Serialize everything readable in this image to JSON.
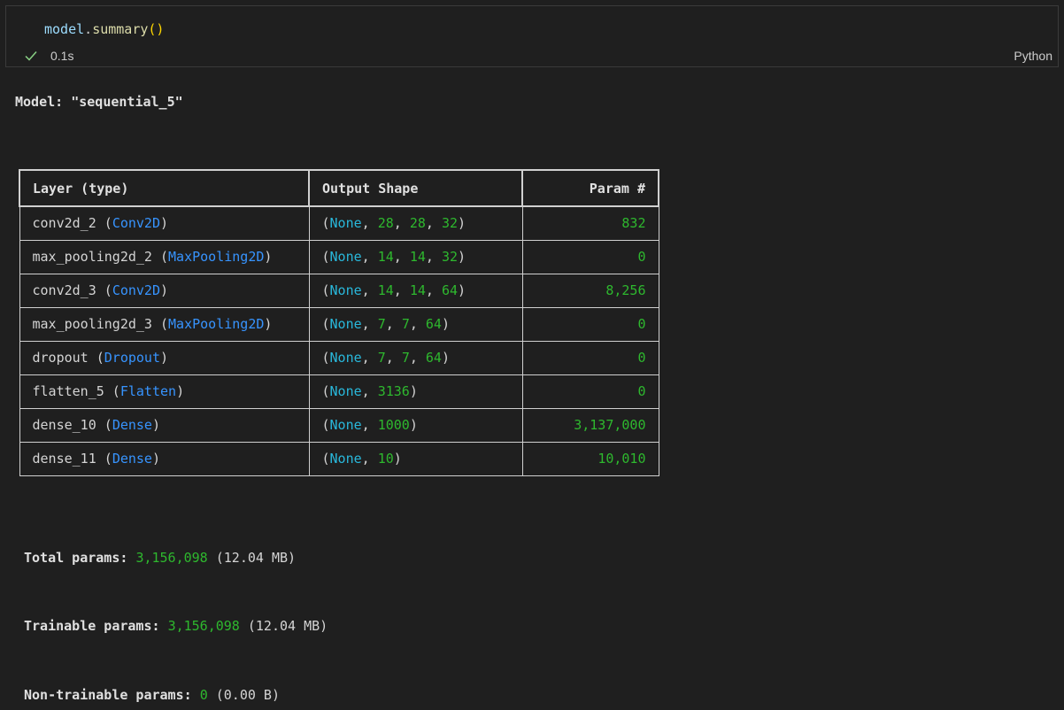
{
  "cell": {
    "code": {
      "var": "model",
      "dot": ".",
      "fn": "summary",
      "parens": "()"
    },
    "status": {
      "icon": "check-icon",
      "duration": "0.1s"
    },
    "language": "Python"
  },
  "output": {
    "model_label": "Model: ",
    "model_name": "\"sequential_5\"",
    "table": {
      "headers": {
        "layer": "Layer (type)",
        "shape": "Output Shape",
        "param": "Param #"
      },
      "rows": [
        {
          "name": "conv2d_2",
          "type": "Conv2D",
          "shape": [
            "None",
            "28",
            "28",
            "32"
          ],
          "params": "832"
        },
        {
          "name": "max_pooling2d_2",
          "type": "MaxPooling2D",
          "shape": [
            "None",
            "14",
            "14",
            "32"
          ],
          "params": "0"
        },
        {
          "name": "conv2d_3",
          "type": "Conv2D",
          "shape": [
            "None",
            "14",
            "14",
            "64"
          ],
          "params": "8,256"
        },
        {
          "name": "max_pooling2d_3",
          "type": "MaxPooling2D",
          "shape": [
            "None",
            "7",
            "7",
            "64"
          ],
          "params": "0"
        },
        {
          "name": "dropout",
          "type": "Dropout",
          "shape": [
            "None",
            "7",
            "7",
            "64"
          ],
          "params": "0"
        },
        {
          "name": "flatten_5",
          "type": "Flatten",
          "shape": [
            "None",
            "3136"
          ],
          "params": "0"
        },
        {
          "name": "dense_10",
          "type": "Dense",
          "shape": [
            "None",
            "1000"
          ],
          "params": "3,137,000"
        },
        {
          "name": "dense_11",
          "type": "Dense",
          "shape": [
            "None",
            "10"
          ],
          "params": "10,010"
        }
      ]
    },
    "totals": {
      "total": {
        "label": "Total params:",
        "value": "3,156,098",
        "size": "(12.04 MB)"
      },
      "trainable": {
        "label": "Trainable params:",
        "value": "3,156,098",
        "size": "(12.04 MB)"
      },
      "non_trainable": {
        "label": "Non-trainable params:",
        "value": "0",
        "size": "(0.00 B)"
      }
    }
  }
}
